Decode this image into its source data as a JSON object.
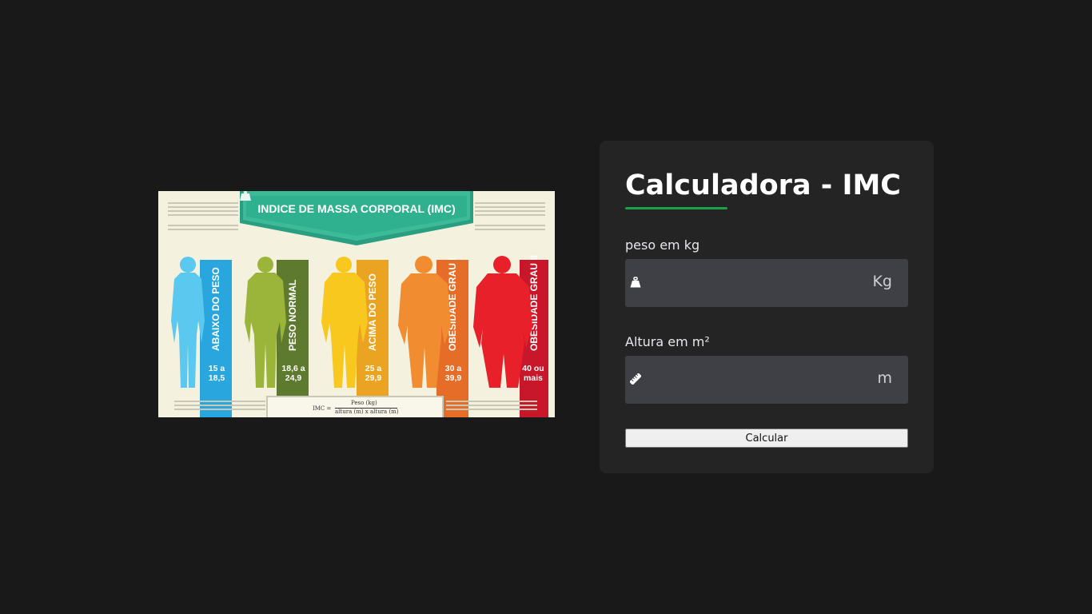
{
  "infographic": {
    "title": "INDICE DE MASSA CORPORAL (IMC)",
    "categories": [
      {
        "label": "ABAIXO DO PESO",
        "range_1": "15 a",
        "range_2": "18,5",
        "color": "#5bc8f0",
        "bar_color": "#2aa6de"
      },
      {
        "label": "PESO NORMAL",
        "range_1": "18,6 a",
        "range_2": "24,9",
        "color": "#9bb43a",
        "bar_color": "#5e7a2e"
      },
      {
        "label": "ACIMA DO PESO",
        "range_1": "25 a",
        "range_2": "29,9",
        "color": "#f8c81e",
        "bar_color": "#eaa422"
      },
      {
        "label": "OBESIDADE GRAU I",
        "range_1": "30 a",
        "range_2": "39,9",
        "color": "#f28c30",
        "bar_color": "#e56d28"
      },
      {
        "label": "OBESIDADE GRAU II",
        "range_1": "40 ou",
        "range_2": "mais",
        "color": "#e8202a",
        "bar_color": "#c8162a"
      }
    ],
    "formula": {
      "lhs": "IMC =",
      "numerator": "Peso (kg)",
      "denominator": "altura (m) x altura (m)"
    },
    "colors": {
      "banner": "#2fb08f",
      "background": "#f4f2de"
    }
  },
  "calculator": {
    "title": "Calculadora - IMC",
    "weight": {
      "label": "peso em kg",
      "value": "",
      "placeholder": "",
      "unit": "Kg",
      "icon": "weight-icon"
    },
    "height": {
      "label": "Altura em m²",
      "value": "",
      "placeholder": "",
      "unit": "m",
      "icon": "ruler-icon"
    },
    "button_label": "Calcular",
    "colors": {
      "accent": "#1aa14c",
      "card": "#242424",
      "field": "#3f3f46",
      "page": "#19191a"
    }
  }
}
